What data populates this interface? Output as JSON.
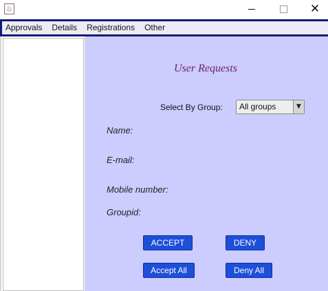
{
  "window": {
    "icon": "java-icon",
    "controls": {
      "minimize": "minimize-icon",
      "maximize": "maximize-icon",
      "close": "close-icon"
    }
  },
  "menubar": {
    "items": [
      "Approvals",
      "Details",
      "Registrations",
      "Other"
    ]
  },
  "main": {
    "heading": "User Requests",
    "group_filter": {
      "label": "Select By Group:",
      "selected": "All groups"
    },
    "fields": {
      "name": "Name:",
      "email": "E-mail:",
      "mobile": "Mobile number:",
      "groupid": "Groupid:"
    },
    "buttons": {
      "accept": "ACCEPT",
      "deny": "DENY",
      "accept_all": "Accept All",
      "deny_all": "Deny All"
    }
  },
  "colors": {
    "panel_background": "#ccccff",
    "heading": "#6b1f6e",
    "button": "#1e4fd9",
    "frame_border": "#0f1a78"
  }
}
